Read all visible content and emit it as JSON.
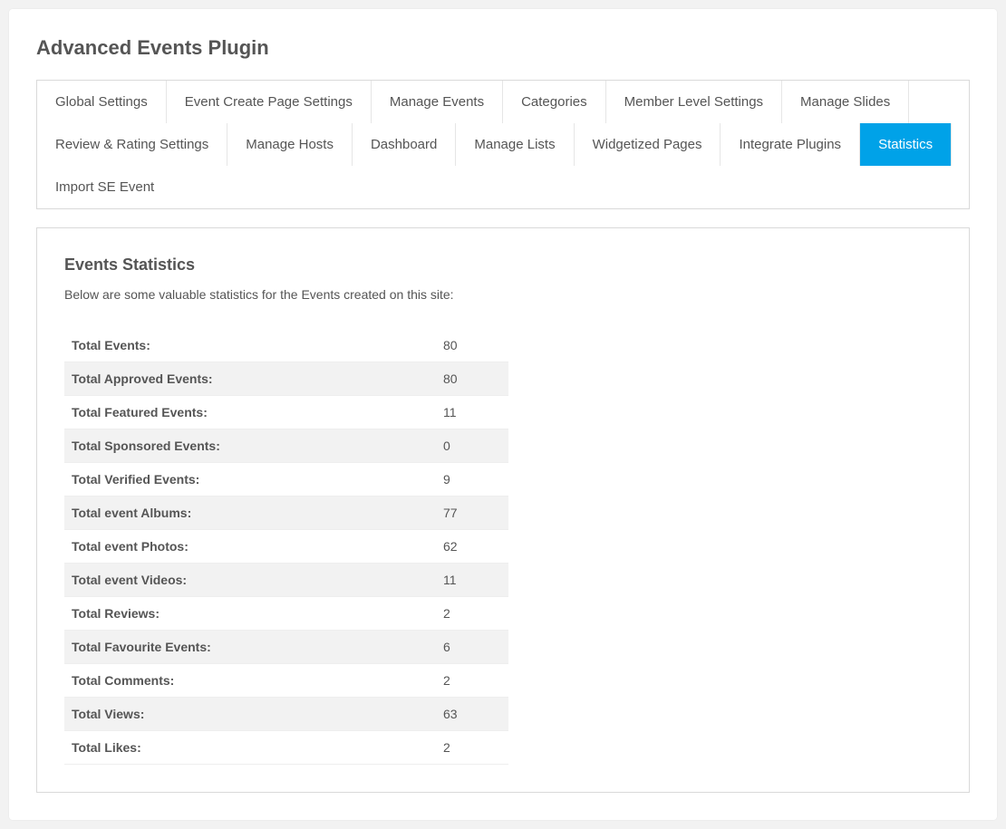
{
  "pageTitle": "Advanced Events Plugin",
  "tabs": [
    {
      "label": "Global Settings",
      "active": false
    },
    {
      "label": "Event Create Page Settings",
      "active": false
    },
    {
      "label": "Manage Events",
      "active": false
    },
    {
      "label": "Categories",
      "active": false
    },
    {
      "label": "Member Level Settings",
      "active": false
    },
    {
      "label": "Manage Slides",
      "active": false
    },
    {
      "label": "Review & Rating Settings",
      "active": false
    },
    {
      "label": "Manage Hosts",
      "active": false
    },
    {
      "label": "Dashboard",
      "active": false
    },
    {
      "label": "Manage Lists",
      "active": false
    },
    {
      "label": "Widgetized Pages",
      "active": false
    },
    {
      "label": "Integrate Plugins",
      "active": false
    },
    {
      "label": "Statistics",
      "active": true
    },
    {
      "label": "Import SE Event",
      "active": false
    }
  ],
  "section": {
    "title": "Events Statistics",
    "description": "Below are some valuable statistics for the Events created on this site:"
  },
  "stats": [
    {
      "label": "Total Events:",
      "value": "80"
    },
    {
      "label": "Total Approved Events:",
      "value": "80"
    },
    {
      "label": "Total Featured Events:",
      "value": "11"
    },
    {
      "label": "Total Sponsored Events:",
      "value": "0"
    },
    {
      "label": "Total Verified Events:",
      "value": "9"
    },
    {
      "label": "Total event Albums:",
      "value": "77"
    },
    {
      "label": "Total event Photos:",
      "value": "62"
    },
    {
      "label": "Total event Videos:",
      "value": "11"
    },
    {
      "label": "Total Reviews:",
      "value": "2"
    },
    {
      "label": "Total Favourite Events:",
      "value": "6"
    },
    {
      "label": "Total Comments:",
      "value": "2"
    },
    {
      "label": "Total Views:",
      "value": "63"
    },
    {
      "label": "Total Likes:",
      "value": "2"
    }
  ]
}
